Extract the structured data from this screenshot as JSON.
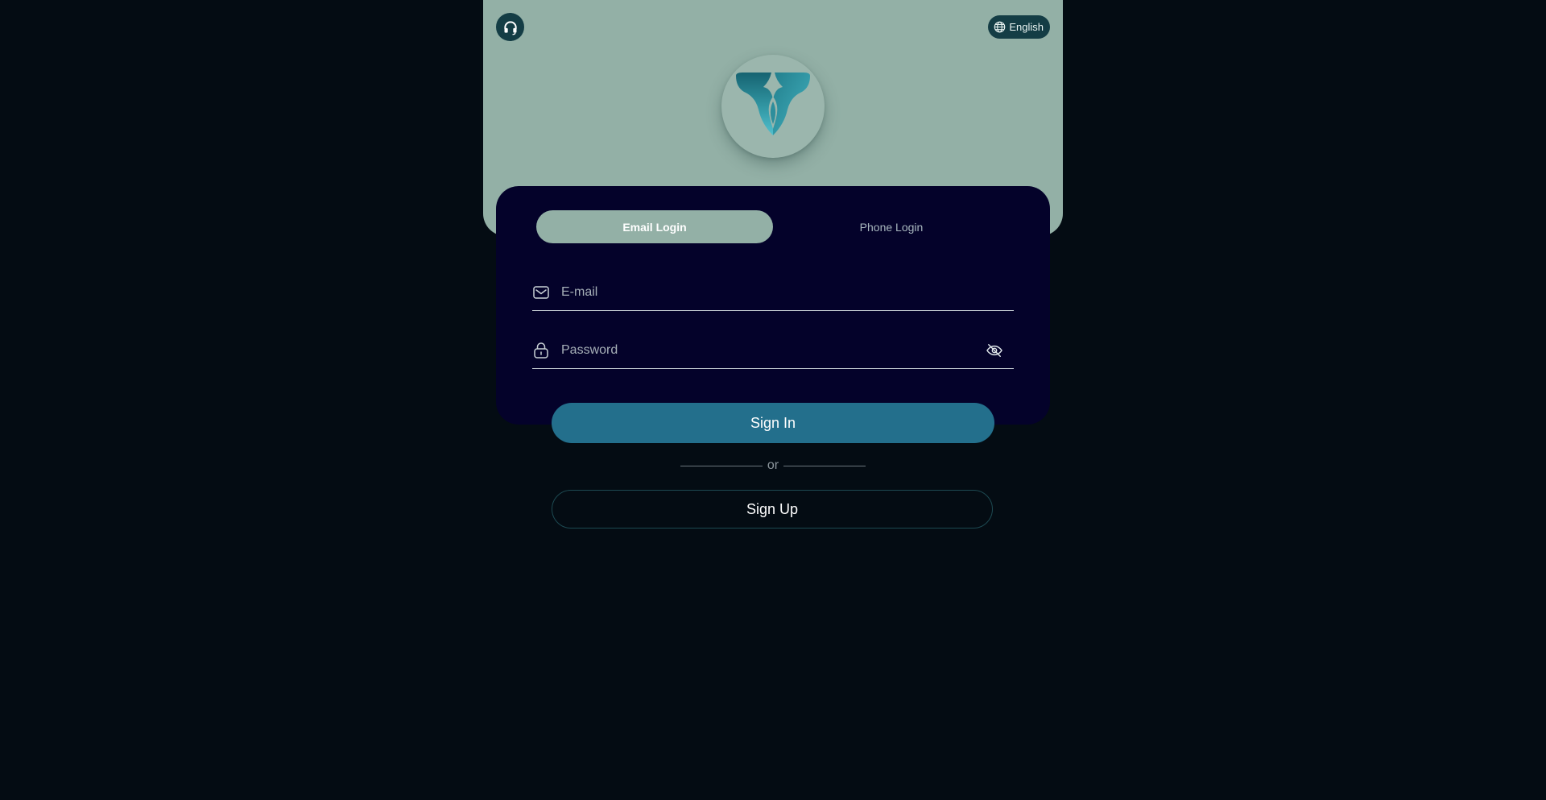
{
  "header": {
    "support_icon": "headset-icon",
    "language": {
      "icon": "globe-icon",
      "label": "English"
    },
    "logo_icon": "app-logo"
  },
  "login": {
    "tabs": [
      {
        "label": "Email Login",
        "active": true
      },
      {
        "label": "Phone Login",
        "active": false
      }
    ],
    "email": {
      "icon": "mail-icon",
      "placeholder": "E-mail",
      "value": ""
    },
    "password": {
      "icon": "lock-icon",
      "placeholder": "Password",
      "value": "",
      "toggle_icon": "eye-off-icon"
    },
    "sign_in_label": "Sign In",
    "divider_label": "or",
    "sign_up_label": "Sign Up"
  },
  "colors": {
    "page_background": "#040c13",
    "hero_background": "#93b0a6",
    "card_background": "#04022a",
    "primary_button": "#236f8c",
    "icon_button_bg": "#143d45"
  }
}
